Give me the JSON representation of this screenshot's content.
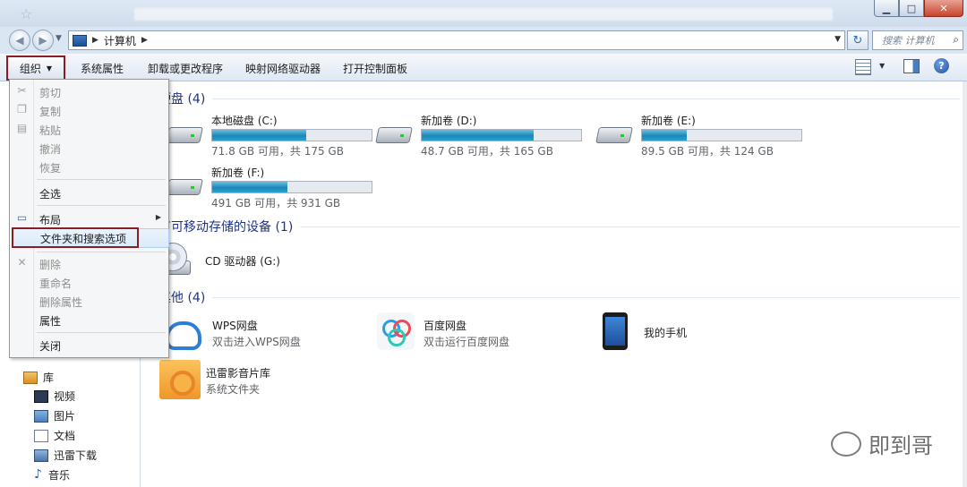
{
  "window": {
    "minimize": "▁",
    "maximize": "□",
    "close": "✕"
  },
  "address": {
    "path": "计算机",
    "search_placeholder": "搜索 计算机"
  },
  "toolbar": {
    "organize": "组织",
    "system_properties": "系统属性",
    "uninstall": "卸载或更改程序",
    "map_drive": "映射网络驱动器",
    "control_panel": "打开控制面板",
    "help": "?"
  },
  "menu": {
    "cut": "剪切",
    "copy": "复制",
    "paste": "粘贴",
    "undo": "撤消",
    "redo": "恢复",
    "select_all": "全选",
    "layout": "布局",
    "folder_options": "文件夹和搜索选项",
    "delete": "删除",
    "rename": "重命名",
    "remove_properties": "删除属性",
    "properties": "属性",
    "close": "关闭"
  },
  "groups": {
    "hdd": "硬盘 (4)",
    "removable": "有可移动存储的设备 (1)",
    "other": "其他 (4)"
  },
  "drives": [
    {
      "name": "本地磁盘 (C:)",
      "info": "71.8 GB 可用，共 175 GB",
      "used_fraction": 0.59
    },
    {
      "name": "新加卷 (D:)",
      "info": "48.7 GB 可用，共 165 GB",
      "used_fraction": 0.7
    },
    {
      "name": "新加卷 (E:)",
      "info": "89.5 GB 可用，共 124 GB",
      "used_fraction": 0.28
    },
    {
      "name": "新加卷 (F:)",
      "info": "491 GB 可用，共 931 GB",
      "used_fraction": 0.47
    }
  ],
  "cd": {
    "name": "CD 驱动器 (G:)"
  },
  "others": [
    {
      "name": "WPS网盘",
      "desc": "双击进入WPS网盘"
    },
    {
      "name": "百度网盘",
      "desc": "双击运行百度网盘"
    },
    {
      "name": "我的手机",
      "desc": ""
    },
    {
      "name": "迅雷影音片库",
      "desc": "系统文件夹"
    }
  ],
  "nav": {
    "library": "库",
    "video": "视频",
    "pictures": "图片",
    "documents": "文档",
    "thunder": "迅雷下载",
    "music": "音乐"
  },
  "watermark": "即到哥"
}
